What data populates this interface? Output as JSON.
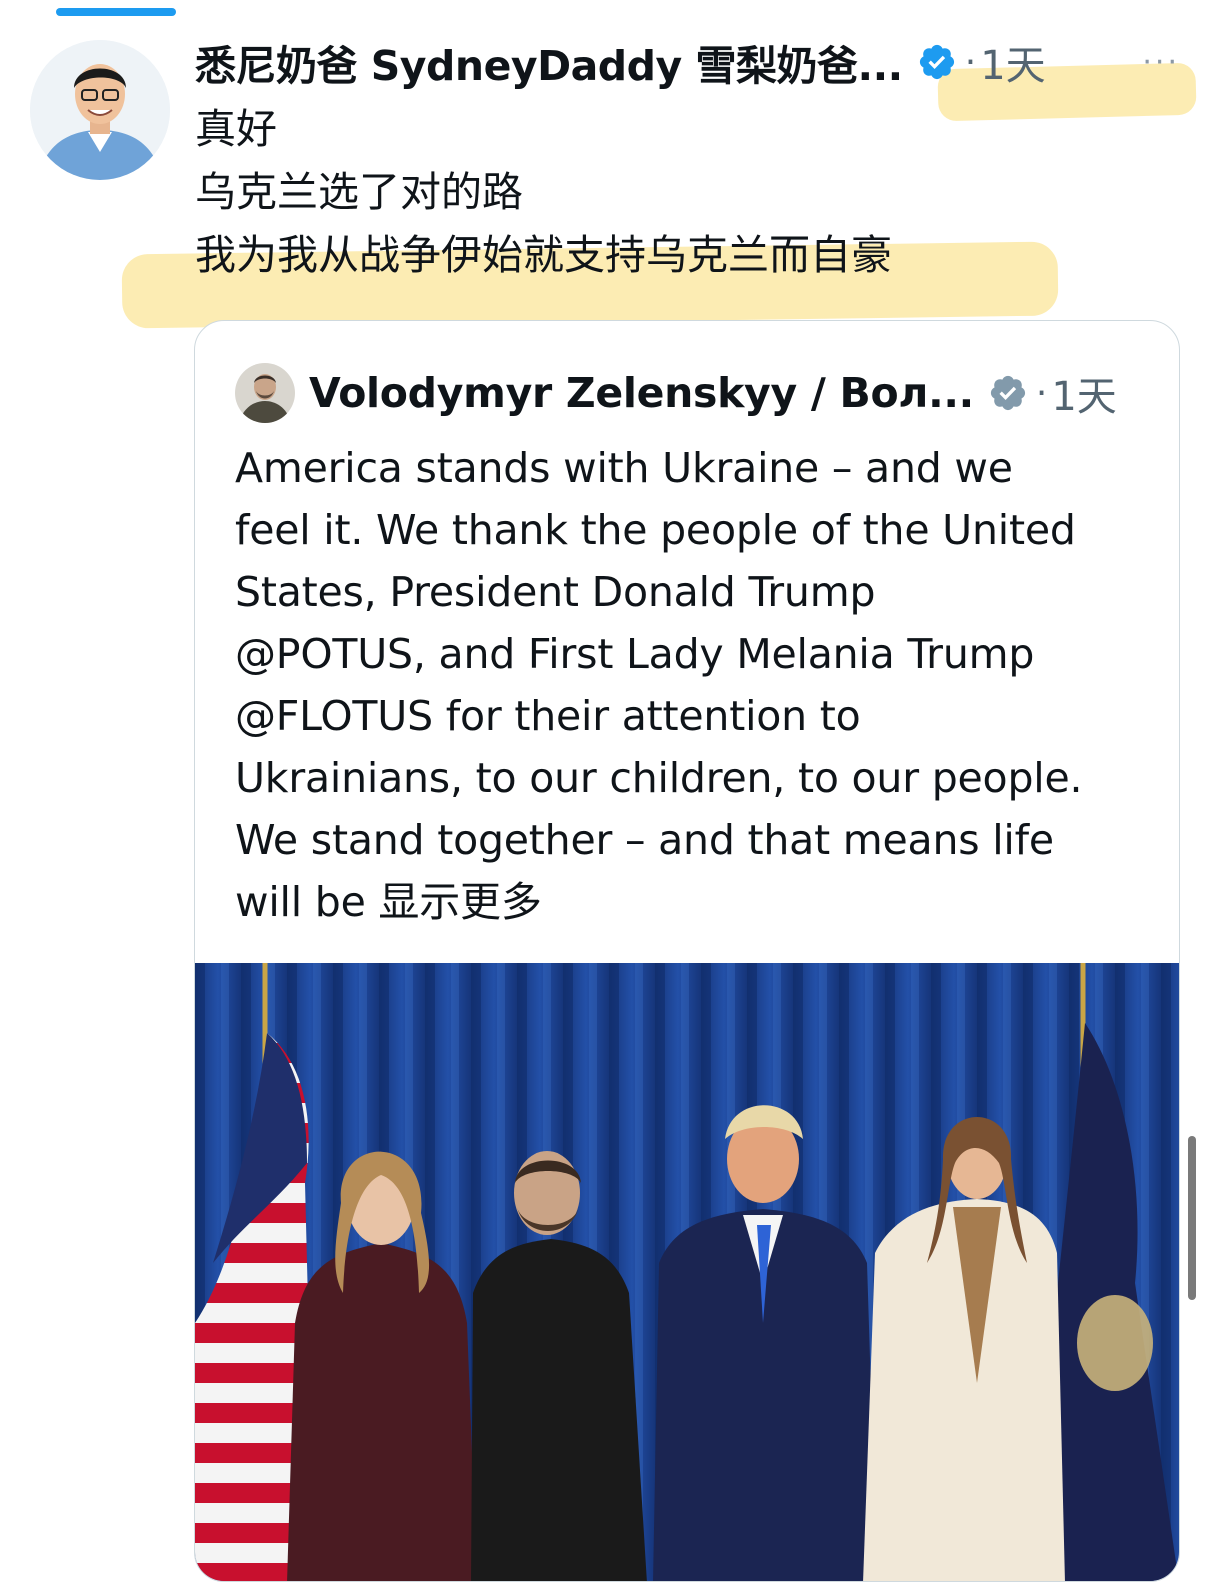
{
  "post": {
    "author_name": "悉尼奶爸 SydneyDaddy 雪梨奶爸...",
    "dot": "·",
    "time": "1天",
    "more": "···",
    "lines": [
      "真好",
      "乌克兰选了对的路",
      "我为我从战争伊始就支持乌克兰而自豪"
    ]
  },
  "quote": {
    "author_name": "Volodymyr Zelenskyy / Вол...",
    "dot": "·",
    "time": "1天",
    "text_lines": [
      "America stands with Ukraine – and we",
      "feel it. We thank the people of the United",
      "States, President Donald Trump",
      "@POTUS, and First Lady Melania Trump",
      "@FLOTUS for their attention to",
      "Ukrainians, to our children, to our people.",
      "We stand together – and that means life",
      "will be "
    ],
    "show_more": "显示更多"
  },
  "icons": {
    "verified": "verified-badge-icon",
    "more": "more-horizontal-icon"
  },
  "colors": {
    "accent": "#1d9bf0",
    "verified": "#1d9bf0",
    "highlight": "#fbe7a0",
    "muted_text": "#536471",
    "curtain": "#1e3f8a"
  }
}
